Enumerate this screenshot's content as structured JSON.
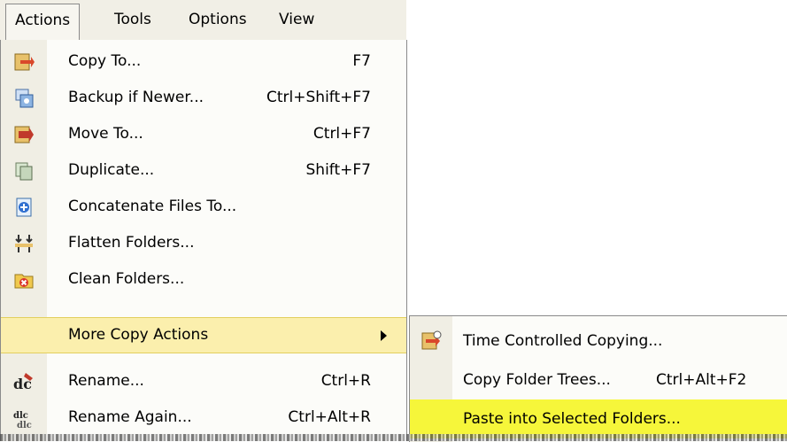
{
  "menubar": {
    "items": [
      {
        "label": "Actions",
        "active": true
      },
      {
        "label": "Tools"
      },
      {
        "label": "Options"
      },
      {
        "label": "View"
      }
    ]
  },
  "actions_menu": {
    "items": [
      {
        "icon": "copy-to-icon",
        "label": "Copy To...",
        "shortcut": "F7"
      },
      {
        "icon": "backup-icon",
        "label": "Backup if Newer...",
        "shortcut": "Ctrl+Shift+F7"
      },
      {
        "icon": "move-to-icon",
        "label": "Move To...",
        "shortcut": "Ctrl+F7"
      },
      {
        "icon": "duplicate-icon",
        "label": "Duplicate...",
        "shortcut": "Shift+F7"
      },
      {
        "icon": "concatenate-icon",
        "label": "Concatenate Files To...",
        "shortcut": ""
      },
      {
        "icon": "flatten-icon",
        "label": "Flatten Folders...",
        "shortcut": ""
      },
      {
        "icon": "clean-folders-icon",
        "label": "Clean Folders...",
        "shortcut": ""
      },
      {
        "icon": "",
        "label": "More Copy Actions",
        "shortcut": "",
        "submenu": true,
        "highlighted": true
      },
      {
        "icon": "rename-icon",
        "label": "Rename...",
        "shortcut": "Ctrl+R"
      },
      {
        "icon": "rename-again-icon",
        "label": "Rename Again...",
        "shortcut": "Ctrl+Alt+R"
      }
    ]
  },
  "more_copy_submenu": {
    "items": [
      {
        "icon": "time-copy-icon",
        "label": "Time Controlled Copying...",
        "shortcut": ""
      },
      {
        "icon": "",
        "label": "Copy Folder Trees...",
        "shortcut": "Ctrl+Alt+F2"
      },
      {
        "icon": "",
        "label": "Paste into Selected Folders...",
        "shortcut": "",
        "highlighted": true
      }
    ]
  },
  "colors": {
    "highlight": "#fbefad",
    "yellow_marker": "#f6f63a",
    "menubar_bg": "#f1efe6"
  }
}
